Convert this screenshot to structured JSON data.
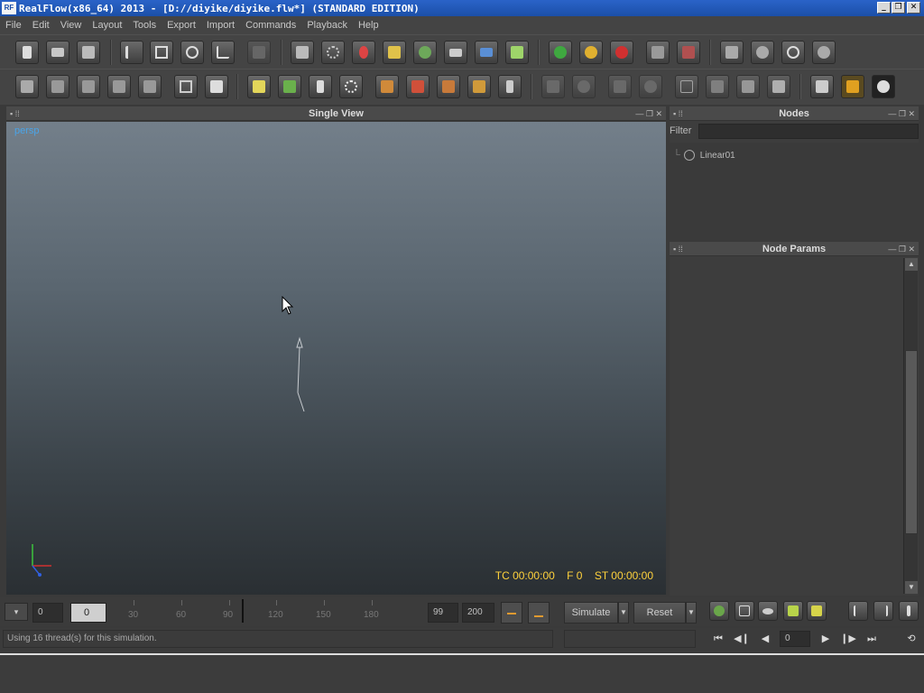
{
  "window": {
    "title": "RealFlow(x86_64) 2013 - [D://diyike/diyike.flw*] (STANDARD EDITION)",
    "logo_text": "RF",
    "minimize_symbol": "_",
    "maximize_symbol": "❐",
    "close_symbol": "✕"
  },
  "menu": [
    "File",
    "Edit",
    "View",
    "Layout",
    "Tools",
    "Export",
    "Import",
    "Commands",
    "Playback",
    "Help"
  ],
  "viewport": {
    "title": "Single View",
    "camera_label": "persp",
    "timecode": "TC 00:00:00",
    "frame": "F 0",
    "sim_time": "ST 00:00:00"
  },
  "nodes_panel": {
    "title": "Nodes",
    "filter_label": "Filter",
    "filter_value": "",
    "items": [
      "Linear01"
    ]
  },
  "node_params_panel": {
    "title": "Node Params"
  },
  "timeline": {
    "start_value": "0",
    "current_value": "0",
    "end_value": "99",
    "max_value": "200",
    "ticks": [
      "30",
      "60",
      "90",
      "120",
      "150",
      "180"
    ],
    "current_frame_fraction": 0.0
  },
  "buttons": {
    "simulate": "Simulate",
    "reset": "Reset"
  },
  "playback": {
    "frame_value": "0"
  },
  "status": {
    "message": "Using 16 thread(s) for this simulation."
  },
  "colors": {
    "accent_blue": "#4aa4e8",
    "timecode_yellow": "#ffd23c",
    "titlebar": "#1b4fa8"
  }
}
